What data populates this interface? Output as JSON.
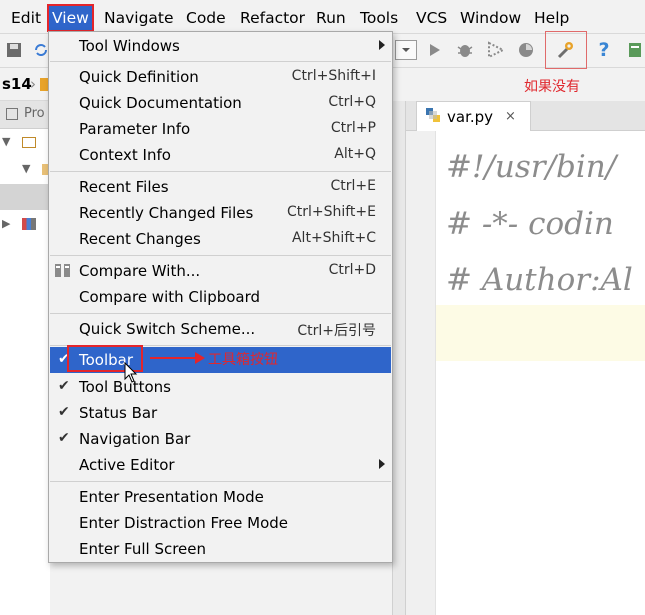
{
  "menubar": {
    "items": [
      {
        "label": "Edit"
      },
      {
        "label": "View"
      },
      {
        "label": "Navigate"
      },
      {
        "label": "Code"
      },
      {
        "label": "Refactor"
      },
      {
        "label": "Run"
      },
      {
        "label": "Tools"
      },
      {
        "label": "VCS"
      },
      {
        "label": "Window"
      },
      {
        "label": "Help"
      }
    ],
    "active": "View"
  },
  "annotations": {
    "if_missing": "如果没有",
    "toolbar_hint": "工具箱按钮"
  },
  "breadcrumb": {
    "project": "s14"
  },
  "project_panel": {
    "tab_label": "Pro"
  },
  "editor": {
    "tab_label": "var.py",
    "close_glyph": "×",
    "lines": [
      "#!/usr/bin/",
      "# -*- codin",
      "# Author:Al"
    ]
  },
  "view_menu": {
    "tool_windows": "Tool Windows",
    "quick_definition": {
      "label": "Quick Definition",
      "shortcut": "Ctrl+Shift+I"
    },
    "quick_documentation": {
      "label": "Quick Documentation",
      "shortcut": "Ctrl+Q"
    },
    "parameter_info": {
      "label": "Parameter Info",
      "shortcut": "Ctrl+P"
    },
    "context_info": {
      "label": "Context Info",
      "shortcut": "Alt+Q"
    },
    "recent_files": {
      "label": "Recent Files",
      "shortcut": "Ctrl+E"
    },
    "recently_changed_files": {
      "label": "Recently Changed Files",
      "shortcut": "Ctrl+Shift+E"
    },
    "recent_changes": {
      "label": "Recent Changes",
      "shortcut": "Alt+Shift+C"
    },
    "compare_with": {
      "label": "Compare With...",
      "shortcut": "Ctrl+D"
    },
    "compare_clipboard": {
      "label": "Compare with Clipboard"
    },
    "quick_switch": {
      "label": "Quick Switch Scheme...",
      "shortcut": "Ctrl+后引号"
    },
    "toolbar": {
      "label": "Toolbar",
      "checked": true
    },
    "tool_buttons": {
      "label": "Tool Buttons",
      "checked": true
    },
    "status_bar": {
      "label": "Status Bar",
      "checked": true
    },
    "navigation_bar": {
      "label": "Navigation Bar",
      "checked": true
    },
    "active_editor": {
      "label": "Active Editor"
    },
    "presentation_mode": {
      "label": "Enter Presentation Mode"
    },
    "distraction_free": {
      "label": "Enter Distraction Free Mode"
    },
    "full_screen": {
      "label": "Enter Full Screen"
    },
    "check_glyph": "✔"
  },
  "colors": {
    "menu_highlight": "#2f65ca",
    "annotation_red": "#e4252b"
  }
}
